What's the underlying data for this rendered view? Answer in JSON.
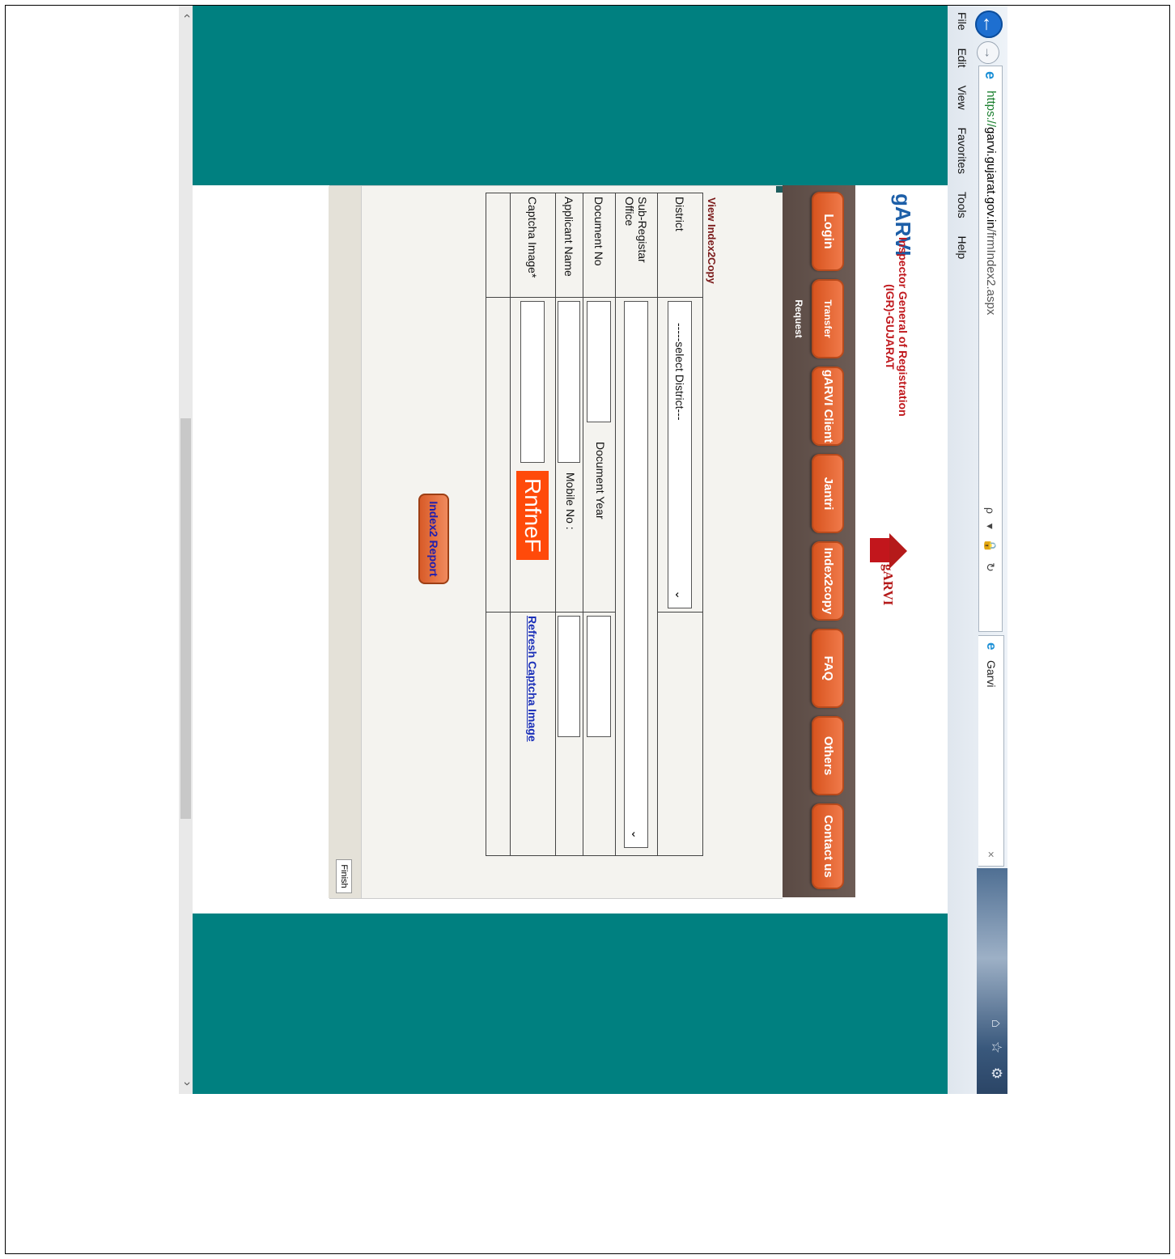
{
  "browser": {
    "url_prefix": "https://",
    "url_domain": "garvi.gujarat.gov.in",
    "url_path": "/frmIndex2.aspx",
    "address_tools": "ρ ▾ 🔒 ↻",
    "tab_title": "Garvi",
    "tab_close": "×",
    "window_icons": "⌂ ☆ ⚙",
    "menu": [
      "File",
      "Edit",
      "View",
      "Favorites",
      "Tools",
      "Help"
    ]
  },
  "header": {
    "brand": "gARVI",
    "subtitle_line1": "Inspector General of Registration",
    "subtitle_line2": "(IGR)-GUJARAT",
    "logo_text": "gARVI"
  },
  "nav": [
    {
      "label": "Login"
    },
    {
      "label": "Transfer Request"
    },
    {
      "label": "gARVI Client"
    },
    {
      "label": "Jantri"
    },
    {
      "label": "Index2copy"
    },
    {
      "label": "FAQ"
    },
    {
      "label": "Others"
    },
    {
      "label": "Contact us"
    }
  ],
  "form": {
    "title": "View Index2Copy",
    "district_label": "District",
    "district_value": "-----select District---",
    "subregistrar_label": "Sub-Registar Office",
    "document_no_label": "Document No",
    "document_year_label": "Document Year",
    "applicant_name_label": "Applicant Name",
    "mobile_label": "Mobile No :",
    "captcha_label": "Captcha Image*",
    "captcha_text": "RnfneF",
    "refresh_link": "Refresh Captcha Image",
    "submit_label": "Index2 Report",
    "finish_label": "Finish"
  },
  "colors": {
    "teal": "#008080",
    "nav_button": "#e2632e",
    "captcha_bg": "#ff4a0a",
    "brand_blue": "#1d5fa8",
    "brand_red": "#c0181d"
  }
}
